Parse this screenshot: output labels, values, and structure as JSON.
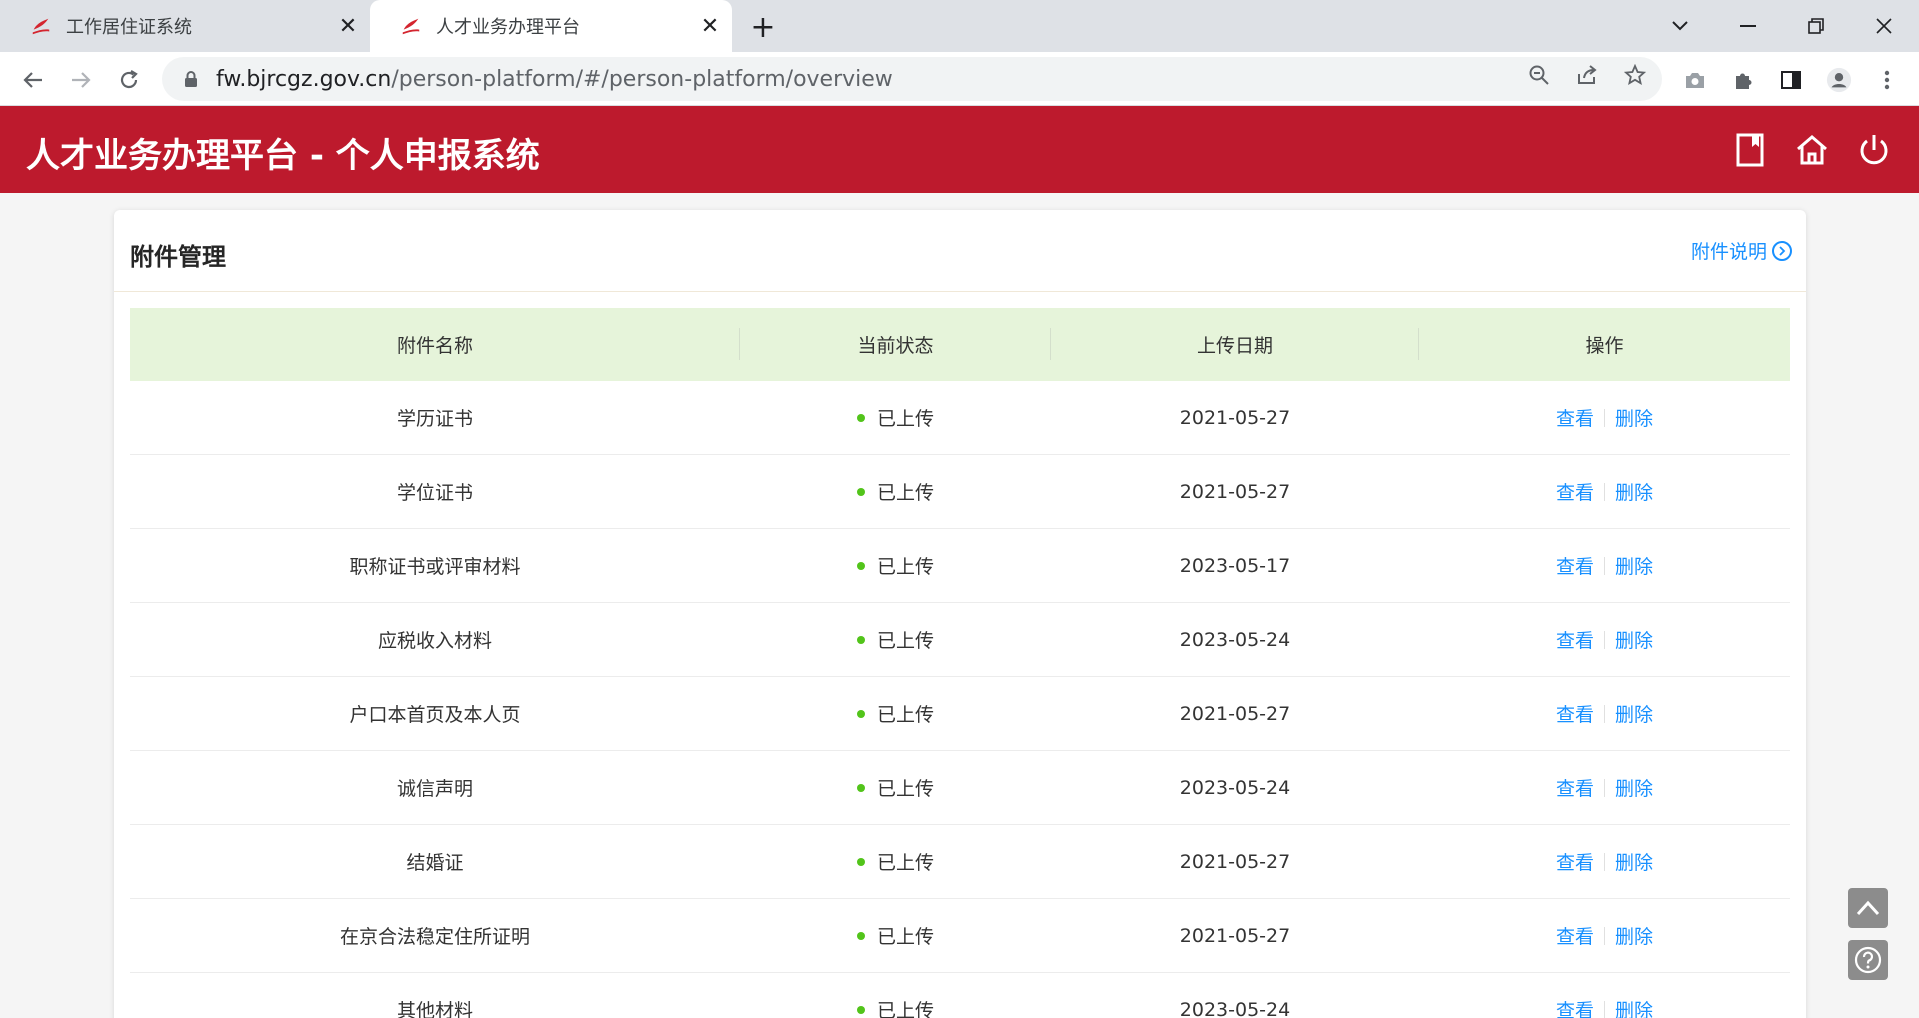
{
  "browser": {
    "tabs": [
      {
        "title": "工作居住证系统",
        "active": false
      },
      {
        "title": "人才业务办理平台",
        "active": true
      }
    ],
    "url_host": "fw.bjrcgz.gov.cn",
    "url_path": "/person-platform/#/person-platform/overview"
  },
  "header": {
    "title": "人才业务办理平台 - 个人申报系统",
    "icons": [
      "book-icon",
      "home-icon",
      "power-icon"
    ]
  },
  "card": {
    "title": "附件管理",
    "help_label": "附件说明"
  },
  "table": {
    "columns": [
      "附件名称",
      "当前状态",
      "上传日期",
      "操作"
    ],
    "view_label": "查看",
    "delete_label": "删除",
    "rows": [
      {
        "name": "学历证书",
        "status": "已上传",
        "date": "2021-05-27"
      },
      {
        "name": "学位证书",
        "status": "已上传",
        "date": "2021-05-27"
      },
      {
        "name": "职称证书或评审材料",
        "status": "已上传",
        "date": "2023-05-17"
      },
      {
        "name": "应税收入材料",
        "status": "已上传",
        "date": "2023-05-24"
      },
      {
        "name": "户口本首页及本人页",
        "status": "已上传",
        "date": "2021-05-27"
      },
      {
        "name": "诚信声明",
        "status": "已上传",
        "date": "2023-05-24"
      },
      {
        "name": "结婚证",
        "status": "已上传",
        "date": "2021-05-27"
      },
      {
        "name": "在京合法稳定住所证明",
        "status": "已上传",
        "date": "2021-05-27"
      },
      {
        "name": "其他材料",
        "status": "已上传",
        "date": "2023-05-24"
      }
    ]
  },
  "colors": {
    "brand_red": "#bd1a2d",
    "table_header_bg": "#e6f4da",
    "link_blue": "#1890ff",
    "status_green": "#52c41a"
  }
}
